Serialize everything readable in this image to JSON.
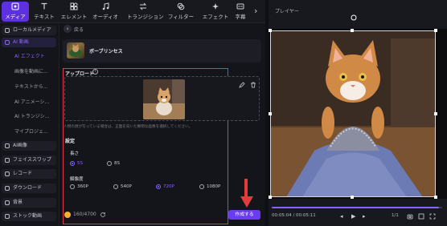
{
  "toolbar": {
    "items": [
      {
        "label": "メディア",
        "icon": "media-icon",
        "active": true
      },
      {
        "label": "テキスト",
        "icon": "text-icon"
      },
      {
        "label": "エレメント",
        "icon": "element-icon"
      },
      {
        "label": "オーディオ",
        "icon": "audio-icon"
      },
      {
        "label": "トランジション",
        "icon": "transition-icon"
      },
      {
        "label": "フィルター",
        "icon": "filter-icon"
      },
      {
        "label": "エフェクト",
        "icon": "effect-icon"
      },
      {
        "label": "字幕",
        "icon": "subtitle-icon"
      }
    ],
    "more_icon": "chevron-right-icon"
  },
  "sidebar": {
    "items": [
      {
        "label": "ローカルメディア",
        "type": "group"
      },
      {
        "label": "AI 動画",
        "type": "open"
      },
      {
        "label": "AI エフェクト",
        "type": "sub-active"
      },
      {
        "label": "画像を動画に...",
        "type": "sub"
      },
      {
        "label": "テキストから...",
        "type": "sub"
      },
      {
        "label": "AI アニメーシ...",
        "type": "sub"
      },
      {
        "label": "AI トランジシ...",
        "type": "sub"
      },
      {
        "label": "マイプロジェ...",
        "type": "sub"
      },
      {
        "label": "AI画像",
        "type": "group"
      },
      {
        "label": "フェイススワップ",
        "type": "group"
      },
      {
        "label": "レコード",
        "type": "group"
      },
      {
        "label": "ダウンロード",
        "type": "group"
      },
      {
        "label": "背景",
        "type": "group"
      },
      {
        "label": "ストック動画",
        "type": "group"
      }
    ]
  },
  "main": {
    "back_label": "戻る",
    "style_name": "ボーブリンセス",
    "upload_title": "アップロード",
    "note": "人物の顔が写っている場合は、正面を向いた鮮明な画像を選択してください。",
    "settings_title": "設定",
    "length_title": "長さ",
    "length_options": [
      {
        "label": "5S",
        "selected": true
      },
      {
        "label": "8S",
        "selected": false
      }
    ],
    "resolution_title": "解像度",
    "resolution_options": [
      {
        "label": "360P",
        "selected": false
      },
      {
        "label": "540P",
        "selected": false
      },
      {
        "label": "720P",
        "selected": true
      },
      {
        "label": "1080P",
        "selected": false
      }
    ],
    "credits": "160/4700",
    "create_label": "作成する"
  },
  "player": {
    "title": "プレイヤー",
    "timecode": "00:05:04 / 00:05:11",
    "speed": "1/1",
    "progress_fraction": 0.98
  },
  "colors": {
    "accent": "#6a3cf0",
    "highlight_box": "#e23b3b"
  }
}
